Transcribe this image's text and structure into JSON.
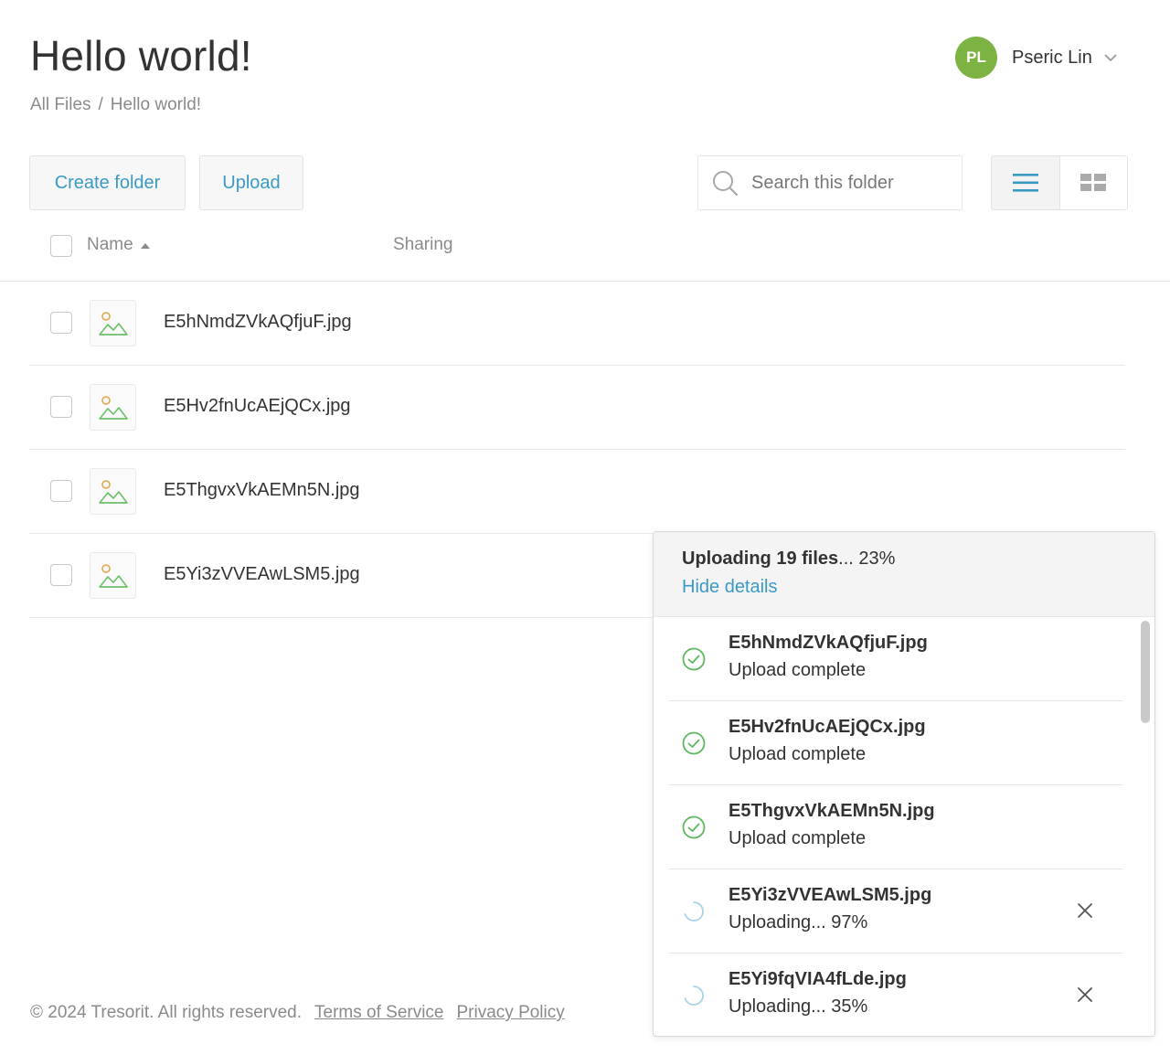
{
  "page": {
    "title": "Hello world!"
  },
  "breadcrumb": {
    "root": "All Files",
    "separator": "/",
    "current": "Hello world!"
  },
  "user": {
    "initials": "PL",
    "name": "Pseric Lin",
    "avatar_color": "#7cb342"
  },
  "toolbar": {
    "create_folder_label": "Create folder",
    "upload_label": "Upload",
    "search_placeholder": "Search this folder",
    "view_modes": [
      "list-view-icon",
      "grid-view-icon"
    ],
    "active_view": "list"
  },
  "list_header": {
    "name": "Name",
    "sharing": "Sharing",
    "sort": "ascending"
  },
  "files": [
    {
      "name": "E5hNmdZVkAQfjuF.jpg",
      "icon": "image-file-icon"
    },
    {
      "name": "E5Hv2fnUcAEjQCx.jpg",
      "icon": "image-file-icon"
    },
    {
      "name": "E5ThgvxVkAEMn5N.jpg",
      "icon": "image-file-icon"
    },
    {
      "name": "E5Yi3zVVEAwLSM5.jpg",
      "icon": "image-file-icon"
    }
  ],
  "upload_panel": {
    "title_bold": "Uploading 19 files",
    "title_rest": "... 23%",
    "hide_details": "Hide details",
    "items": [
      {
        "name": "E5hNmdZVkAQfjuF.jpg",
        "status": "Upload complete",
        "state": "complete"
      },
      {
        "name": "E5Hv2fnUcAEjQCx.jpg",
        "status": "Upload complete",
        "state": "complete"
      },
      {
        "name": "E5ThgvxVkAEMn5N.jpg",
        "status": "Upload complete",
        "state": "complete"
      },
      {
        "name": "E5Yi3zVVEAwLSM5.jpg",
        "status": "Uploading... 97%",
        "state": "uploading",
        "progress": 0.97
      },
      {
        "name": "E5Yi9fqVIA4fLde.jpg",
        "status": "Uploading... 35%",
        "state": "uploading",
        "progress": 0.35
      }
    ]
  },
  "footer": {
    "copyright": "© 2024 Tresorit. All rights reserved.",
    "terms": "Terms of Service",
    "privacy": "Privacy Policy"
  },
  "colors": {
    "accent": "#3a9ac4",
    "success": "#5cb85c",
    "avatar": "#7cb342"
  }
}
